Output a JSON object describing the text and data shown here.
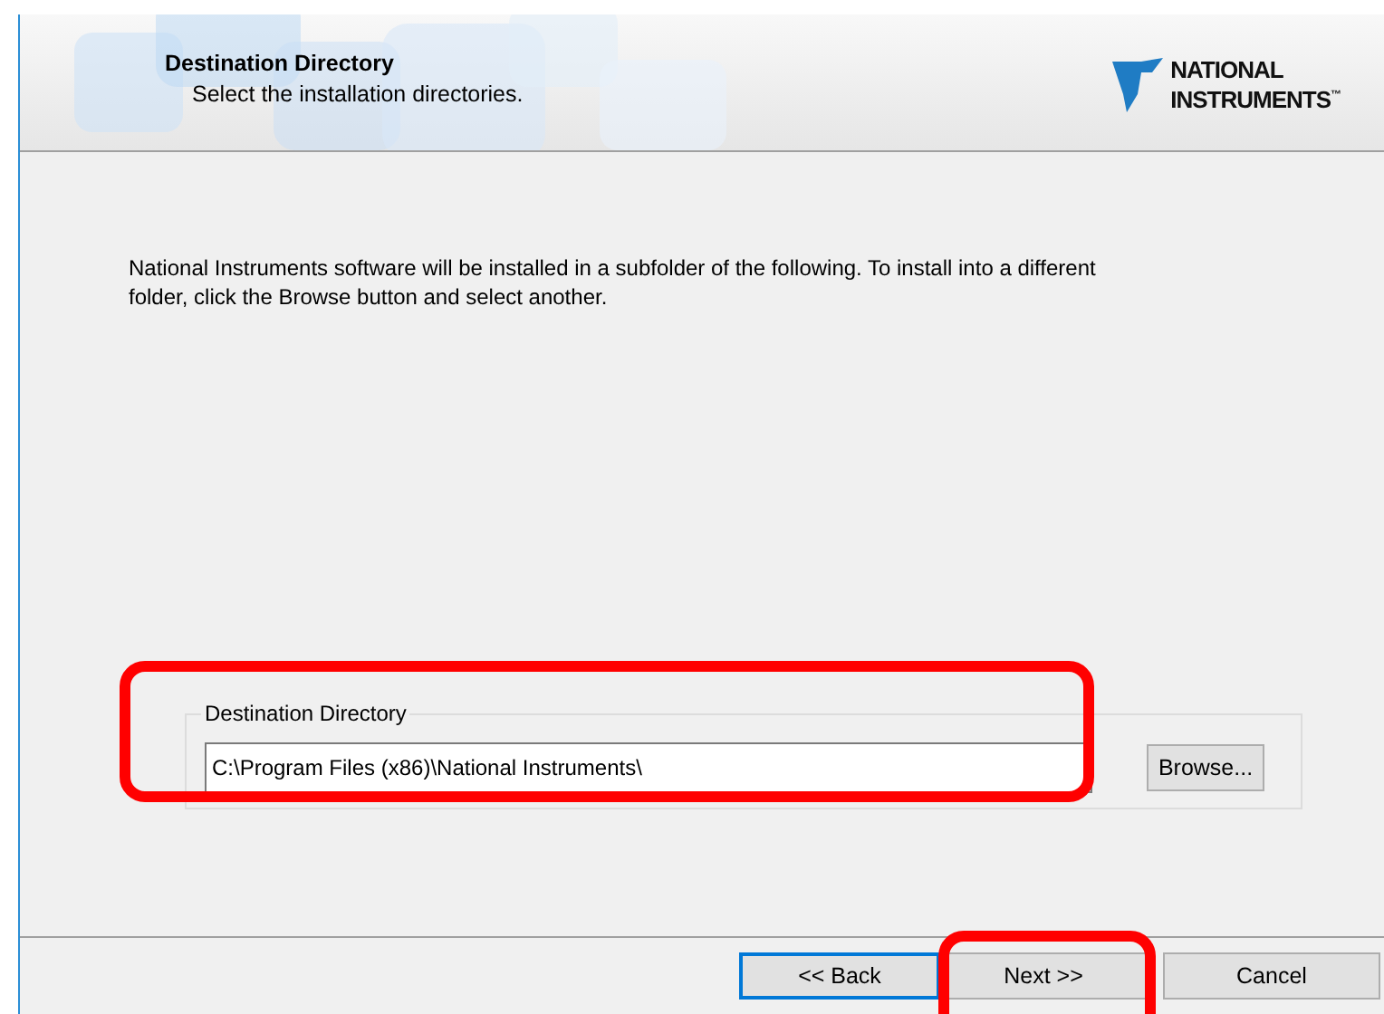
{
  "header": {
    "title": "Destination Directory",
    "subtitle": "Select the installation directories.",
    "logo_lines": [
      "NATIONAL",
      "INSTRUMENTS"
    ],
    "logo_mark": "™"
  },
  "description": "National Instruments software will be installed in a subfolder of the following. To install into a different folder, click the Browse button and select another.",
  "destination": {
    "label": "Destination Directory",
    "value": "C:\\Program Files (x86)\\National Instruments\\",
    "browse": "Browse..."
  },
  "buttons": [
    {
      "label": "<< Back",
      "focused": true
    },
    {
      "label": "Next >>",
      "focused": false
    },
    {
      "label": "Cancel",
      "focused": false
    }
  ],
  "highlights": [
    {
      "kind": "ring"
    },
    {
      "kind": "ring"
    }
  ]
}
